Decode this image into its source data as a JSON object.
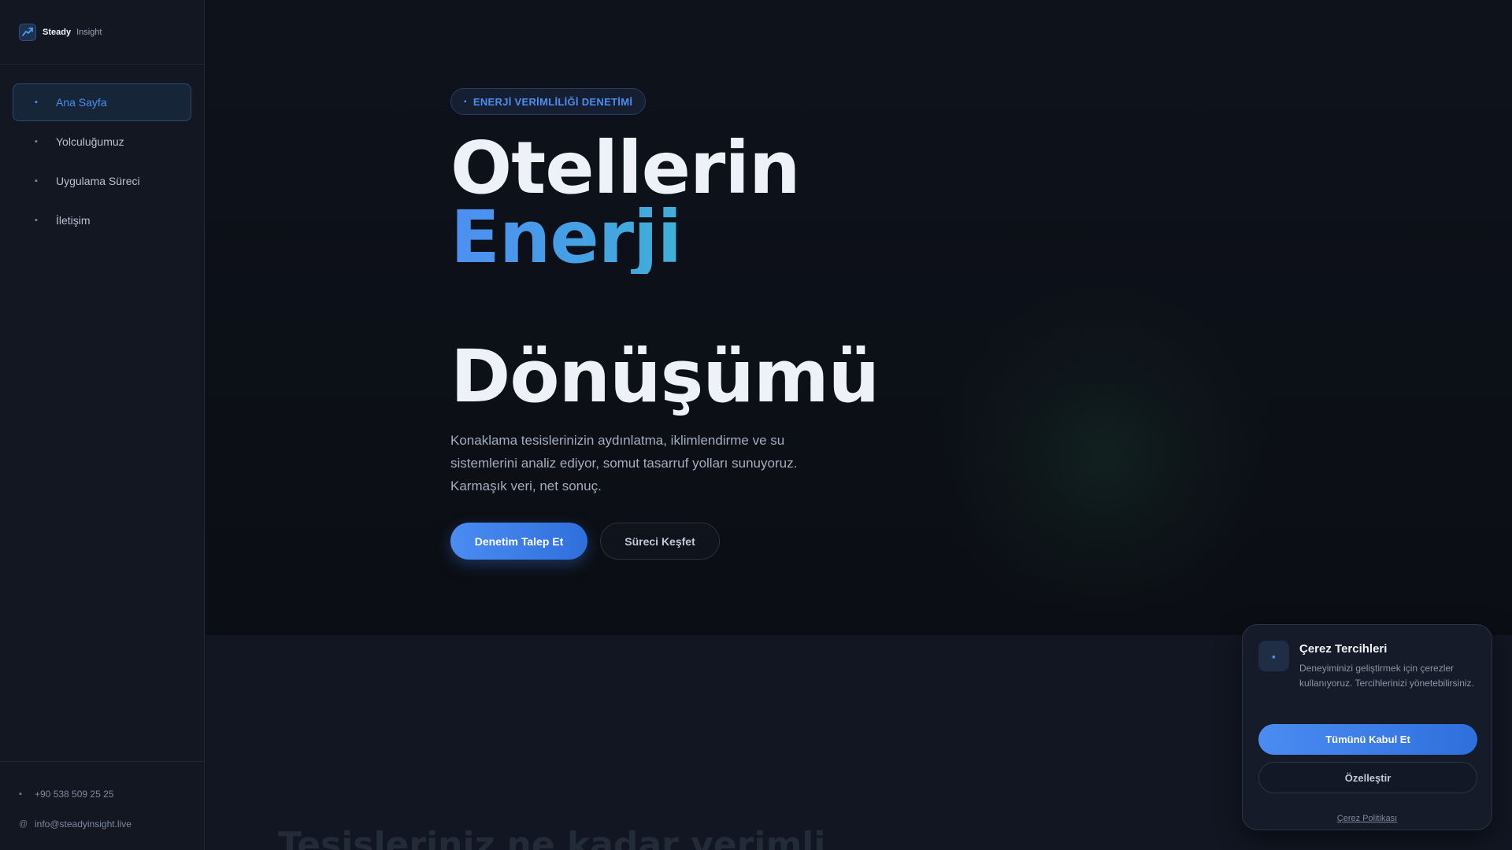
{
  "brand": {
    "name": "Steady",
    "sub": "Insight"
  },
  "sidebar": {
    "items": [
      {
        "label": "Ana Sayfa",
        "icon": "home-icon",
        "active": true
      },
      {
        "label": "Yolculuğumuz",
        "icon": "route-icon",
        "active": false
      },
      {
        "label": "Uygulama Süreci",
        "icon": "process-icon",
        "active": false
      },
      {
        "label": "İletişim",
        "icon": "contact-icon",
        "active": false
      }
    ],
    "footer": {
      "phone": "+90 538 509 25 25",
      "email": "info@steadyinsight.live",
      "email_icon": "@"
    }
  },
  "hero": {
    "badge": "ENERJİ VERİMLİLİĞİ DENETİMİ",
    "title_line1": "Otellerin",
    "title_line2": "Enerji",
    "title_line3": "Dönüşümü",
    "description": "Konaklama tesislerinizin aydınlatma, iklimlendirme ve su sistemlerini analiz ediyor, somut tasarruf yolları sunuyoruz. Karmaşık veri, net sonuç.",
    "primary_button": "Denetim Talep Et",
    "secondary_button": "Süreci Keşfet"
  },
  "next_section": {
    "heading": "Tesisleriniz ne kadar verimli"
  },
  "cookie": {
    "title": "Çerez Tercihleri",
    "text": "Deneyiminizi geliştirmek için çerezler kullanıyoruz. Tercihlerinizi yönetebilirsiniz.",
    "accept_label": "Tümünü Kabul Et",
    "customize_label": "Özelleştir",
    "policy_link": "Çerez Politikası"
  },
  "colors": {
    "accent": "#4a8ff0",
    "accent_gradient_end": "#3fb0d8",
    "background": "#0c0f16",
    "sidebar": "#121722"
  }
}
